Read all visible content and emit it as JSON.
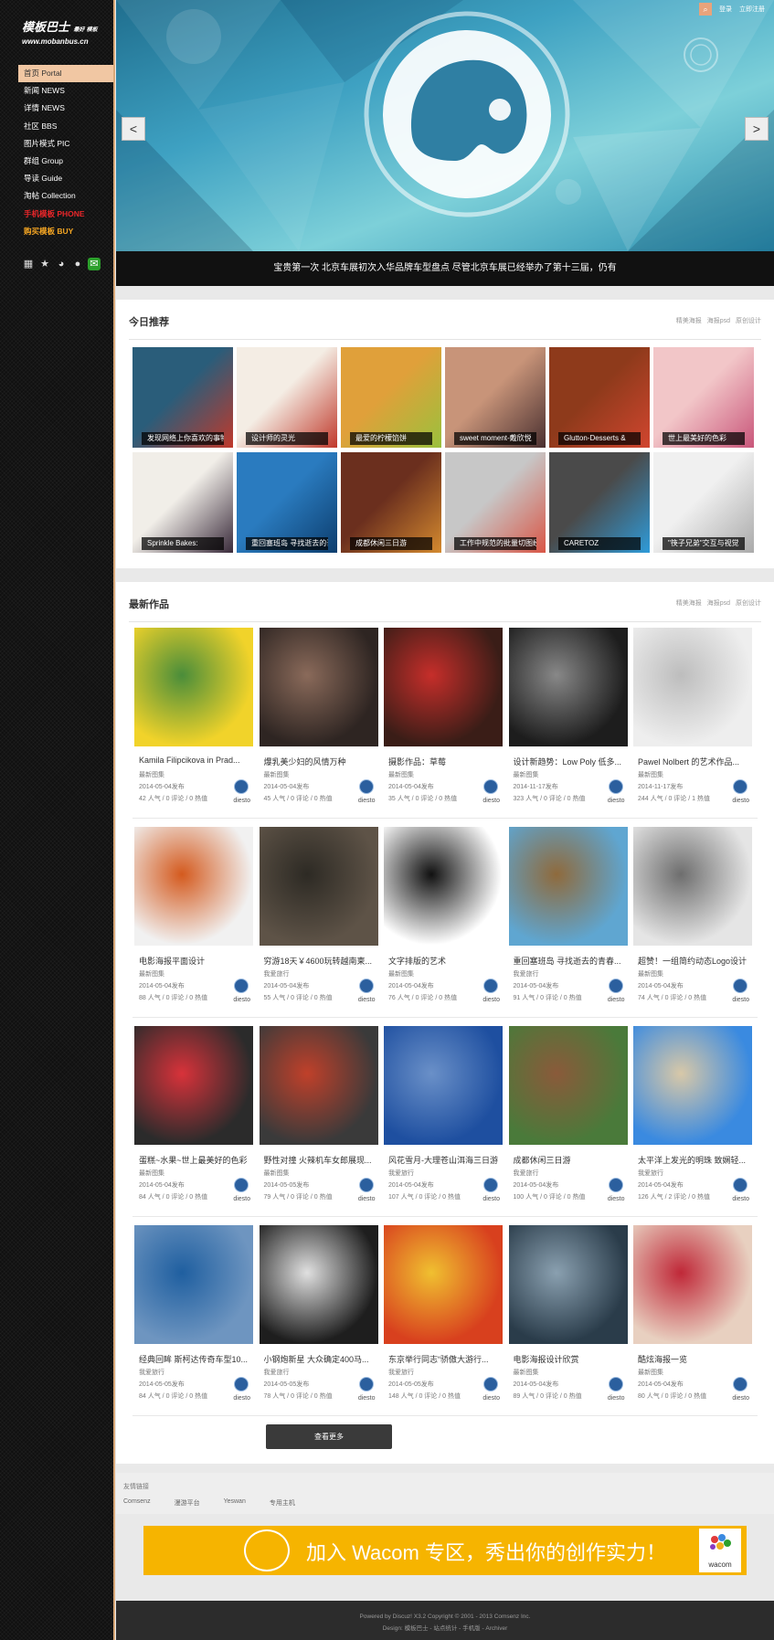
{
  "logo": {
    "cn": "模板巴士",
    "tag": "最好 模板",
    "url": "www.mobanbus.cn"
  },
  "nav": [
    {
      "label": "首页 Portal",
      "state": "active"
    },
    {
      "label": "新闻 NEWS",
      "state": ""
    },
    {
      "label": "详情 NEWS",
      "state": ""
    },
    {
      "label": "社区 BBS",
      "state": ""
    },
    {
      "label": "图片模式 PIC",
      "state": ""
    },
    {
      "label": "群组 Group",
      "state": ""
    },
    {
      "label": "导读 Guide",
      "state": ""
    },
    {
      "label": "淘帖 Collection",
      "state": ""
    },
    {
      "label": "手机模板 PHONE",
      "state": "red"
    },
    {
      "label": "购买模板 BUY",
      "state": "orange"
    }
  ],
  "social_icons": [
    "grid-icon",
    "star-icon",
    "weibo-icon",
    "qq-icon",
    "wechat-icon"
  ],
  "topbar": {
    "login": "登录",
    "register": "立即注册"
  },
  "hero": {
    "caption": "宝贵第一次 北京车展初次入华品牌车型盘点 尽管北京车展已经举办了第十三届，仍有",
    "prev": "<",
    "next": ">"
  },
  "recommend": {
    "title": "今日推荐",
    "links": [
      "精美海报",
      "海报psd",
      "原创设计"
    ],
    "items": [
      {
        "caption": "发现网络上你喜欢的事物",
        "colors": [
          "#2a5d7a",
          "#c0392b"
        ]
      },
      {
        "caption": "设计师的灵光",
        "colors": [
          "#f4ede4",
          "#c0392b"
        ]
      },
      {
        "caption": "最爱的柠檬馅饼",
        "colors": [
          "#e0a03a",
          "#9ac13c"
        ]
      },
      {
        "caption": "sweet moment-戴欣悦",
        "colors": [
          "#c89479",
          "#4a3030"
        ]
      },
      {
        "caption": "Glutton-Desserts &",
        "colors": [
          "#8e3a1b",
          "#d1462f"
        ]
      },
      {
        "caption": "世上最美好的色彩",
        "colors": [
          "#f2c6c8",
          "#c9567a"
        ]
      },
      {
        "caption": "Sprinkle Bakes:",
        "colors": [
          "#f1eee8",
          "#3a2b3b"
        ]
      },
      {
        "caption": "重回塞班岛 寻找逝去的青",
        "colors": [
          "#2a7bbf",
          "#0d3e6e"
        ]
      },
      {
        "caption": "成都休闲三日游",
        "colors": [
          "#6b2f1e",
          "#d48a2f"
        ]
      },
      {
        "caption": "工作中规范的批量切图经",
        "colors": [
          "#c7c7c7",
          "#d95646"
        ]
      },
      {
        "caption": "CARETOZ",
        "colors": [
          "#4a4a4a",
          "#2f9bd9"
        ]
      },
      {
        "caption": "\"筷子兄弟\"交互与视觉",
        "colors": [
          "#f0f0f0",
          "#aaaaaa"
        ]
      }
    ]
  },
  "works": {
    "title": "最新作品",
    "links": [
      "精美海报",
      "海报psd",
      "原创设计"
    ],
    "user": "diesto",
    "items": [
      {
        "title": "Kamila Filipcikova in Prad...",
        "cat": "最新图集",
        "date": "2014-05-04发布",
        "stats": "42 人气 / 0 评论 / 0 热值",
        "colors": [
          "#f1d32a",
          "#4a8d3a"
        ]
      },
      {
        "title": "爆乳美少妇的风情万种",
        "cat": "最新图集",
        "date": "2014-05-04发布",
        "stats": "45 人气 / 0 评论 / 0 热值",
        "colors": [
          "#2e2522",
          "#8a6a5a"
        ]
      },
      {
        "title": "摄影作品：草莓",
        "cat": "最新图集",
        "date": "2014-05-04发布",
        "stats": "35 人气 / 0 评论 / 0 热值",
        "colors": [
          "#3a1d17",
          "#c62e2a"
        ]
      },
      {
        "title": "设计新趋势：Low Poly 低多...",
        "cat": "最新图集",
        "date": "2014-11-17发布",
        "stats": "323 人气 / 0 评论 / 0 热值",
        "colors": [
          "#1d1d1d",
          "#888888"
        ]
      },
      {
        "title": "Pawel Nolbert 的艺术作品...",
        "cat": "最新图集",
        "date": "2014-11-17发布",
        "stats": "244 人气 / 0 评论 / 1 热值",
        "colors": [
          "#eeeeee",
          "#bdbdbd"
        ]
      },
      {
        "title": "电影海报平面设计",
        "cat": "最新图集",
        "date": "2014-05-04发布",
        "stats": "88 人气 / 0 评论 / 0 热值",
        "colors": [
          "#f1f1f1",
          "#d45a1e"
        ]
      },
      {
        "title": "穷游18天￥4600玩转越南柬...",
        "cat": "我爱旅行",
        "date": "2014-05-04发布",
        "stats": "55 人气 / 0 评论 / 0 热值",
        "colors": [
          "#5e5347",
          "#2d2a24"
        ]
      },
      {
        "title": "文字排版的艺术",
        "cat": "最新图集",
        "date": "2014-05-04发布",
        "stats": "76 人气 / 0 评论 / 0 热值",
        "colors": [
          "#ffffff",
          "#111111"
        ]
      },
      {
        "title": "重回塞班岛 寻找逝去的青春...",
        "cat": "我爱旅行",
        "date": "2014-05-04发布",
        "stats": "91 人气 / 0 评论 / 0 热值",
        "colors": [
          "#5fa6d1",
          "#8f6a3c"
        ]
      },
      {
        "title": "超赞！一组简约动态Logo设计",
        "cat": "最新图集",
        "date": "2014-05-04发布",
        "stats": "74 人气 / 0 评论 / 0 热值",
        "colors": [
          "#e5e5e5",
          "#6e6e6e"
        ]
      },
      {
        "title": "蛋糕~水果~世上最美好的色彩",
        "cat": "最新图集",
        "date": "2014-05-04发布",
        "stats": "84 人气 / 0 评论 / 0 热值",
        "colors": [
          "#2b2b2b",
          "#d8323a"
        ]
      },
      {
        "title": "野性对撞 火辣机车女郎展现...",
        "cat": "最新图集",
        "date": "2014-05-05发布",
        "stats": "79 人气 / 0 评论 / 0 热值",
        "colors": [
          "#3a3a3a",
          "#c0402a"
        ]
      },
      {
        "title": "风花雪月-大理苍山洱海三日游",
        "cat": "我爱旅行",
        "date": "2014-05-04发布",
        "stats": "107 人气 / 0 评论 / 0 热值",
        "colors": [
          "#1e4fa0",
          "#6a90c8"
        ]
      },
      {
        "title": "成都休闲三日游",
        "cat": "我爱旅行",
        "date": "2014-05-04发布",
        "stats": "100 人气 / 0 评论 / 0 热值",
        "colors": [
          "#4a7a3a",
          "#8a5a3a"
        ]
      },
      {
        "title": "太平洋上发光的明珠 致娴轻...",
        "cat": "我爱旅行",
        "date": "2014-05-04发布",
        "stats": "126 人气 / 2 评论 / 0 热值",
        "colors": [
          "#3a8ae0",
          "#d8c8a8"
        ]
      },
      {
        "title": "经典回眸 斯柯达传奇车型10...",
        "cat": "我爱旅行",
        "date": "2014-05-05发布",
        "stats": "84 人气 / 0 评论 / 0 热值",
        "colors": [
          "#6e95c0",
          "#1f5fa0"
        ]
      },
      {
        "title": "小钢炮新星 大众确定400马...",
        "cat": "我爱旅行",
        "date": "2014-05-05发布",
        "stats": "78 人气 / 0 评论 / 0 热值",
        "colors": [
          "#1e1e1e",
          "#e0e0e0"
        ]
      },
      {
        "title": "东京举行同志“骄傲大游行...",
        "cat": "我爱旅行",
        "date": "2014-05-05发布",
        "stats": "148 人气 / 0 评论 / 0 热值",
        "colors": [
          "#d8401e",
          "#f0c030"
        ]
      },
      {
        "title": "电影海报设计欣赏",
        "cat": "最新图集",
        "date": "2014-05-04发布",
        "stats": "89 人气 / 0 评论 / 0 热值",
        "colors": [
          "#2a3c4a",
          "#8aa0b0"
        ]
      },
      {
        "title": "酷炫海报一览",
        "cat": "最新图集",
        "date": "2014-05-04发布",
        "stats": "80 人气 / 0 评论 / 0 热值",
        "colors": [
          "#e8d0c0",
          "#c02838"
        ]
      }
    ],
    "more_label": "查看更多"
  },
  "friend_links": {
    "title": "友情链接",
    "items": [
      "Comsenz",
      "漫游平台",
      "Yeswan",
      "专用主机"
    ]
  },
  "banner": {
    "text": "加入 Wacom 专区，秀出你的创作实力！",
    "logo_text": "wacom"
  },
  "footer": {
    "line1": "Powered by Discuz! X3.2 Copyright © 2001 - 2013 Comsenz Inc.",
    "line2": "Design: 模板巴士 - 站点统计 - 手机版 - Archiver"
  }
}
